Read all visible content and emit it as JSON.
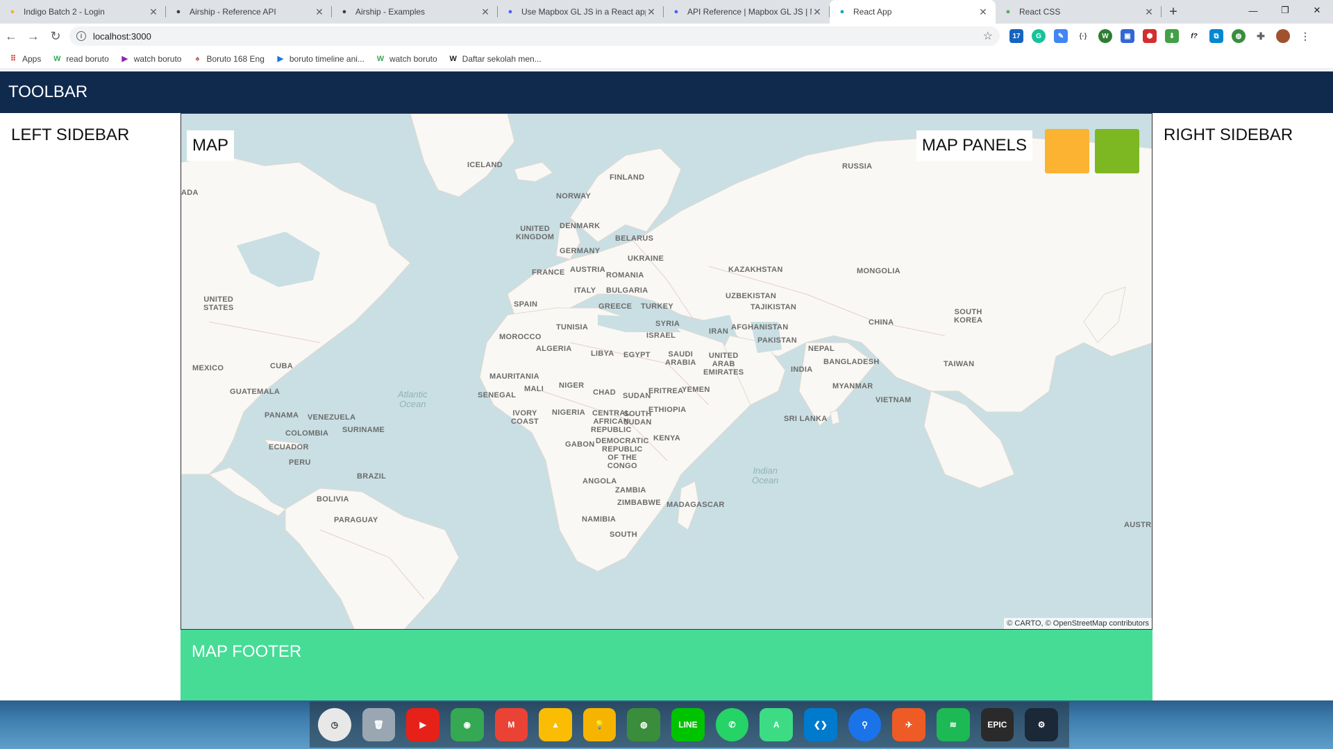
{
  "browser": {
    "tabs": [
      {
        "title": "Indigo Batch 2 - Login",
        "icon": "indigo-favicon",
        "color": "#f0b429"
      },
      {
        "title": "Airship - Reference API",
        "icon": "airship-favicon",
        "color": "#3c4043"
      },
      {
        "title": "Airship - Examples",
        "icon": "airship-favicon",
        "color": "#3c4043"
      },
      {
        "title": "Use Mapbox GL JS in a React app",
        "icon": "mapbox-favicon",
        "color": "#4264fb"
      },
      {
        "title": "API Reference | Mapbox GL JS | M",
        "icon": "mapbox-favicon",
        "color": "#4264fb"
      },
      {
        "title": "React App",
        "icon": "react-favicon",
        "color": "#00a7c4",
        "active": true
      },
      {
        "title": "React CSS",
        "icon": "react-css-favicon",
        "color": "#4caf50"
      }
    ],
    "new_tab_symbol": "+",
    "window_controls": [
      "—",
      "❐",
      "✕"
    ],
    "url": "localhost:3000",
    "bookmarks": [
      {
        "label": "Apps",
        "icon": "apps-grid-icon",
        "color": "#d93025"
      },
      {
        "label": "read boruto",
        "icon": "w-favicon",
        "color": "#3aa757"
      },
      {
        "label": "watch boruto",
        "icon": "play-favicon",
        "color": "#8e24aa"
      },
      {
        "label": "Boruto 168 Eng",
        "icon": "boruto-favicon",
        "color": "#b06060"
      },
      {
        "label": "boruto timeline ani...",
        "icon": "bookmark-favicon",
        "color": "#1a73e8"
      },
      {
        "label": "watch boruto",
        "icon": "w-favicon",
        "color": "#3aa757"
      },
      {
        "label": "Daftar sekolah men...",
        "icon": "wikipedia-favicon",
        "color": "#202124"
      }
    ]
  },
  "app": {
    "toolbar_label": "TOOLBAR",
    "left_sidebar_label": "LEFT SIDEBAR",
    "right_sidebar_label": "RIGHT SIDEBAR",
    "map_label": "MAP",
    "map_panels_label": "MAP PANELS",
    "panel_colors": [
      "#fbb331",
      "#7db823"
    ],
    "map_footer_label": "MAP FOOTER",
    "attribution": "© CARTO, © OpenStreetMap contributors",
    "colors": {
      "toolbar": "#102a4e",
      "footer": "#46dc96",
      "water": "#c9dfe3",
      "land": "#faf8f4"
    }
  },
  "map_labels": {
    "iceland": "ICELAND",
    "finland": "FINLAND",
    "russia": "RUSSIA",
    "norway": "NORWAY",
    "uk": "UNITED\nKINGDOM",
    "denmark": "DENMARK",
    "belarus": "BELARUS",
    "germany": "GERMANY",
    "ukraine": "UKRAINE",
    "france": "FRANCE",
    "austria": "AUSTRIA",
    "romania": "ROMANIA",
    "kazakhstan": "KAZAKHSTAN",
    "mongolia": "MONGOLIA",
    "italy": "ITALY",
    "bulgaria": "BULGARIA",
    "usa": "UNITED\nSTATES",
    "spain": "SPAIN",
    "greece": "GREECE",
    "turkey": "TURKEY",
    "uzbekistan": "UZBEKISTAN",
    "tajikistan": "TAJIKISTAN",
    "syria": "SYRIA",
    "south_korea": "SOUTH\nKOREA",
    "china": "CHINA",
    "tunisia": "TUNISIA",
    "afghanistan": "AFGHANISTAN",
    "iran": "IRAN",
    "morocco": "MOROCCO",
    "israel": "ISRAEL",
    "pakistan": "PAKISTAN",
    "algeria": "ALGERIA",
    "libya": "LIBYA",
    "egypt": "EGYPT",
    "saudi": "SAUDI\nARABIA",
    "uae": "UNITED\nARAB\nEMIRATES",
    "nepal": "NEPAL",
    "bangladesh": "BANGLADESH",
    "taiwan": "TAIWAN",
    "mexico": "MEXICO",
    "cuba": "CUBA",
    "india": "INDIA",
    "mauritania": "MAURITANIA",
    "mali": "MALI",
    "niger": "NIGER",
    "eritrea": "ERITREA",
    "yemen": "YEMEN",
    "myanmar": "MYANMAR",
    "guatemala": "GUATEMALA",
    "senegal": "SENEGAL",
    "chad": "CHAD",
    "sudan": "SUDAN",
    "vietnam": "VIETNAM",
    "ethiopia": "ETHIOPIA",
    "panama": "PANAMA",
    "venezuela": "VENEZUELA",
    "ivory_coast": "IVORY\nCOAST",
    "nigeria": "NIGERIA",
    "car": "CENTRAL\nAFRICAN\nREPUBLIC",
    "south_sudan": "SOUTH\nSUDAN",
    "sri_lanka": "SRI LANKA",
    "suriname": "SURINAME",
    "colombia": "COLOMBIA",
    "ecuador": "ECUADOR",
    "gabon": "GABON",
    "drc": "DEMOCRATIC\nREPUBLIC\nOF THE\nCONGO",
    "kenya": "KENYA",
    "peru": "PERU",
    "brazil": "BRAZIL",
    "angola": "ANGOLA",
    "zambia": "ZAMBIA",
    "bolivia": "BOLIVIA",
    "zimbabwe": "ZIMBABWE",
    "madagascar": "MADAGASCAR",
    "paraguay": "PARAGUAY",
    "namibia": "NAMIBIA",
    "canada_partial": "ADA",
    "australia_partial": "AUSTRAL",
    "south_partial": "SOUTH",
    "atlantic": "Atlantic\nOcean",
    "indian": "Indian\nOcean"
  },
  "dock": [
    {
      "name": "clock",
      "color": "#e8e8e8"
    },
    {
      "name": "trash",
      "color": "#9aa7b3"
    },
    {
      "name": "youtube",
      "color": "#e62117"
    },
    {
      "name": "chrome",
      "color": "#34a853"
    },
    {
      "name": "gmail",
      "color": "#ea4335"
    },
    {
      "name": "google-drive",
      "color": "#fbbc04"
    },
    {
      "name": "google-keep",
      "color": "#f6b400"
    },
    {
      "name": "globe-app",
      "color": "#3a8d3a"
    },
    {
      "name": "line",
      "label": "LINE",
      "color": "#00c300"
    },
    {
      "name": "whatsapp",
      "color": "#25d366"
    },
    {
      "name": "android-studio",
      "color": "#3ddc84"
    },
    {
      "name": "vscode",
      "color": "#007acc"
    },
    {
      "name": "location-app",
      "color": "#1a73e8"
    },
    {
      "name": "postman",
      "color": "#ef5b25"
    },
    {
      "name": "spotify",
      "color": "#1db954"
    },
    {
      "name": "epic-games",
      "label": "EPIC",
      "color": "#2a2a2a"
    },
    {
      "name": "steam",
      "color": "#1b2838"
    }
  ]
}
